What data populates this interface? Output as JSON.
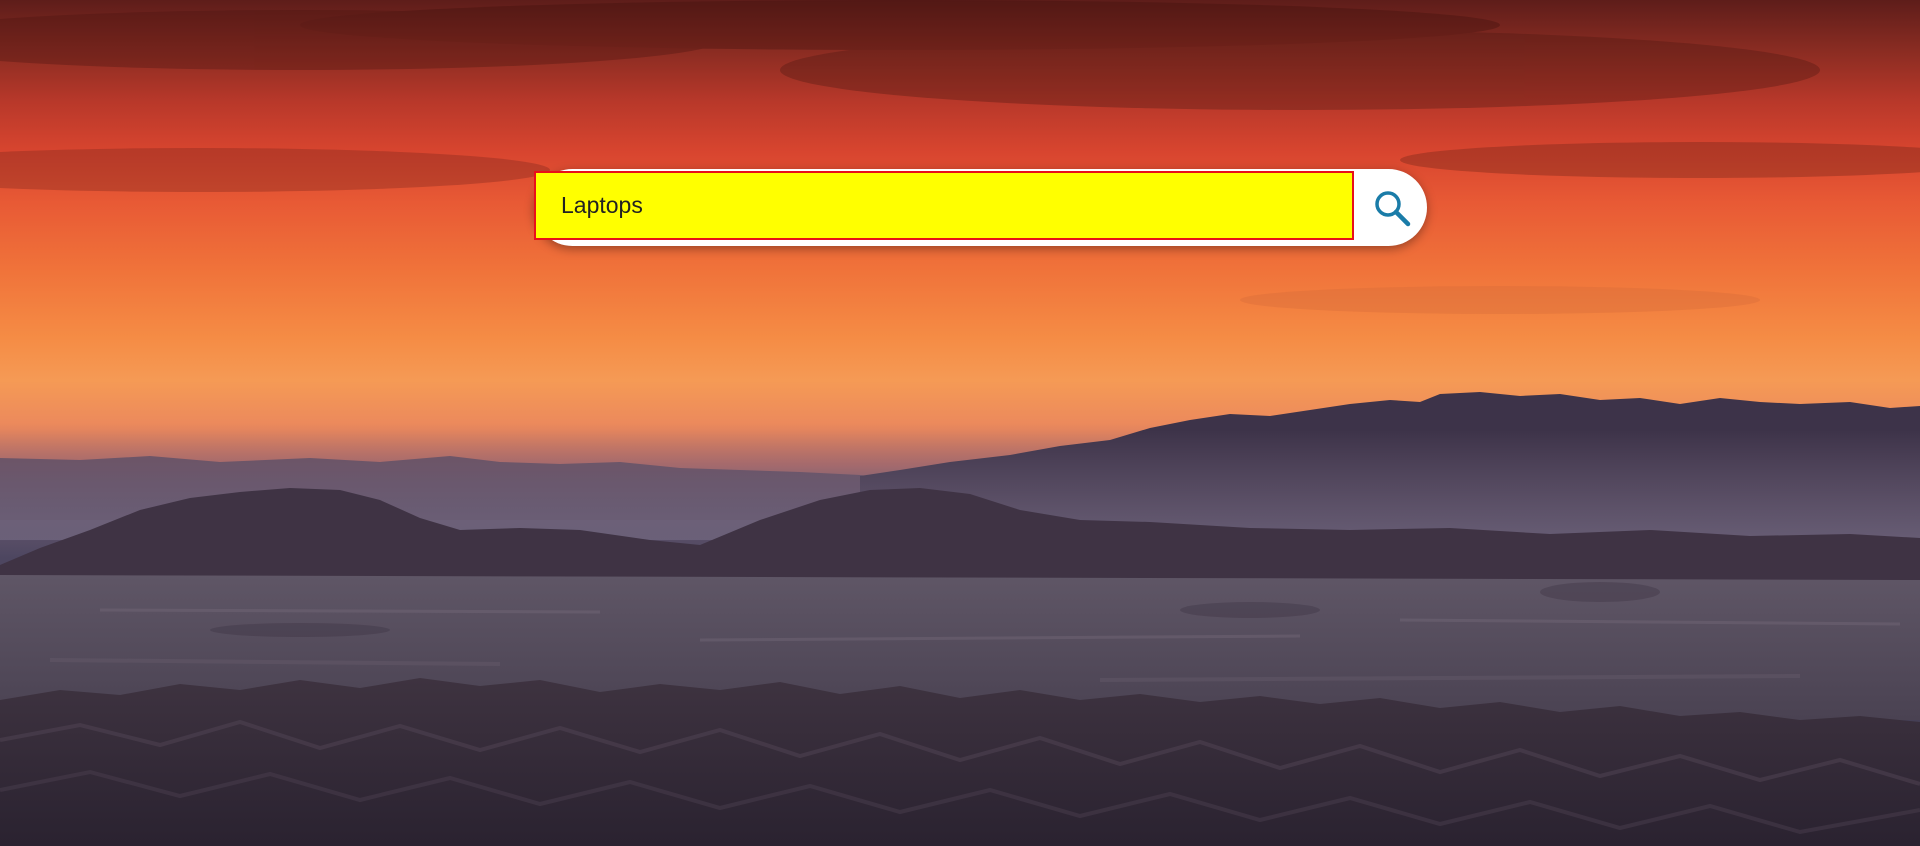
{
  "search": {
    "value": "Laptops",
    "button_icon": "search-icon",
    "input_background": "#ffff00",
    "input_border": "#e8101a",
    "icon_color": "#1a7ca8"
  },
  "background": {
    "description_icon": "desert-sunset-landscape"
  }
}
